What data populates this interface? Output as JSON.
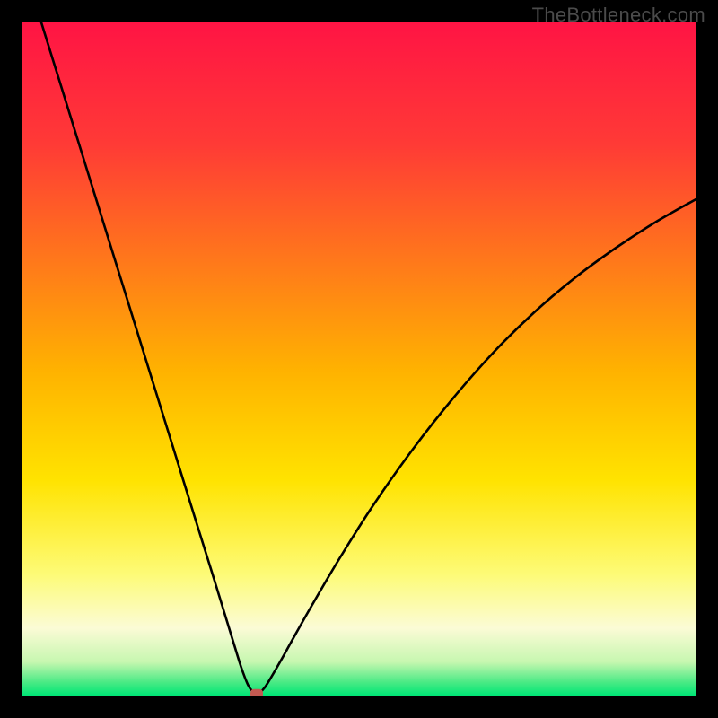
{
  "watermark": "TheBottleneck.com",
  "chart_data": {
    "type": "line",
    "title": "",
    "xlabel": "",
    "ylabel": "",
    "xlim": [
      0,
      1
    ],
    "ylim": [
      0,
      1
    ],
    "series": [
      {
        "name": "curve",
        "x": [
          0.028,
          0.06,
          0.1,
          0.14,
          0.18,
          0.22,
          0.26,
          0.28,
          0.3,
          0.315,
          0.325,
          0.335,
          0.342,
          0.348,
          0.352,
          0.36,
          0.37,
          0.385,
          0.4,
          0.43,
          0.47,
          0.52,
          0.58,
          0.64,
          0.7,
          0.76,
          0.82,
          0.88,
          0.94,
          1.0
        ],
        "y": [
          1.0,
          0.897,
          0.768,
          0.639,
          0.51,
          0.381,
          0.252,
          0.188,
          0.123,
          0.074,
          0.042,
          0.016,
          0.006,
          0.003,
          0.004,
          0.012,
          0.028,
          0.054,
          0.081,
          0.134,
          0.202,
          0.281,
          0.366,
          0.442,
          0.51,
          0.569,
          0.62,
          0.664,
          0.703,
          0.737
        ]
      }
    ],
    "marker": {
      "x": 0.348,
      "y": 0.003,
      "color": "#c45a52"
    },
    "background_gradient": {
      "stops": [
        {
          "pos": 0.0,
          "color": "#ff1444"
        },
        {
          "pos": 0.18,
          "color": "#ff3a36"
        },
        {
          "pos": 0.36,
          "color": "#ff7a1a"
        },
        {
          "pos": 0.52,
          "color": "#ffb300"
        },
        {
          "pos": 0.68,
          "color": "#ffe300"
        },
        {
          "pos": 0.82,
          "color": "#fdfb77"
        },
        {
          "pos": 0.9,
          "color": "#fbfbd6"
        },
        {
          "pos": 0.95,
          "color": "#c7f7b0"
        },
        {
          "pos": 0.98,
          "color": "#4bea85"
        },
        {
          "pos": 1.0,
          "color": "#00e676"
        }
      ]
    }
  }
}
